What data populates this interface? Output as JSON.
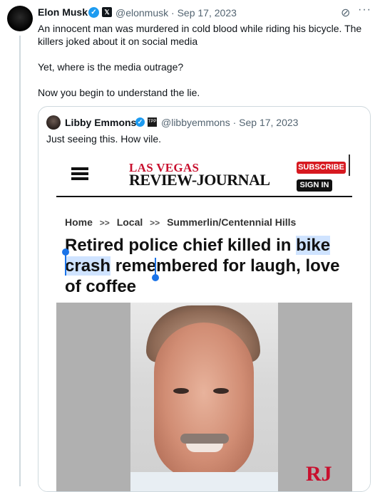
{
  "tweet": {
    "author_name": "Elon Musk",
    "handle": "@elonmusk",
    "separator": "·",
    "date": "Sep 17, 2023",
    "verified_icon": "verified-badge-icon",
    "affiliation_icon": "x-logo-icon",
    "text_lines": [
      "An innocent man was murdered in cold blood while riding his bicycle. The killers joked about it on social media",
      "Yet, where is the media outrage?",
      "Now you begin to understand the lie."
    ],
    "accent_color": "#1d9bf0"
  },
  "quote": {
    "author_name": "Libby Emmons",
    "handle": "@libbyemmons",
    "separator": "·",
    "date": "Sep 17, 2023",
    "text": "Just seeing this. How vile."
  },
  "article": {
    "logo_line1": "LAS VEGAS",
    "logo_line2": "REVIEW-JOURNAL",
    "subscribe_label": "SUBSCRIBE",
    "signin_label": "SIGN IN",
    "breadcrumb": [
      "Home",
      "Local",
      "Summerlin/Centennial Hills"
    ],
    "breadcrumb_sep": ">>",
    "headline_before": "Retired police chief killed in",
    "headline_selected": "bike crash",
    "headline_after": " remembered for laugh, love of coffee",
    "watermark": "RJ",
    "brand_color": "#c8102e"
  }
}
